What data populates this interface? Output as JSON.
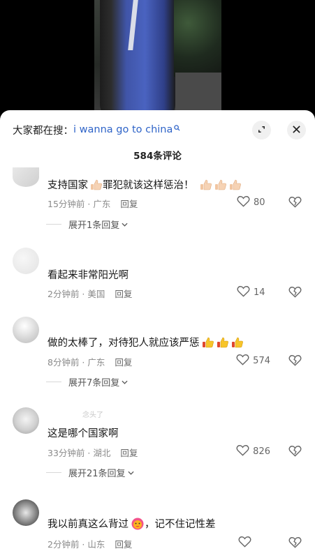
{
  "search": {
    "prefix": "大家都在搜：",
    "query": "i wanna go to china",
    "icon": "search-icon"
  },
  "header": {
    "comment_count_label": "584条评论",
    "expand_icon": "expand-icon",
    "close_icon": "close-icon"
  },
  "comments": [
    {
      "username": "",
      "text": "支持国家👍🏻罪犯就该这样惩治！",
      "text_main": "支持国家",
      "text_mid": "罪犯就该这样惩治！",
      "emoji": "thumbs-up-light",
      "time": "15分钟前",
      "location": "广东",
      "reply_label": "回复",
      "likes": "80",
      "replies_label": "展开1条回复"
    },
    {
      "username": "",
      "text": "看起来非常阳光啊",
      "time": "2分钟前",
      "location": "美国",
      "reply_label": "回复",
      "likes": "14",
      "replies_label": ""
    },
    {
      "username": "",
      "text": "做的太棒了，对待犯人就应该严惩",
      "emoji": "thumbs-up-yellow",
      "time": "8分钟前",
      "location": "广东",
      "reply_label": "回复",
      "likes": "574",
      "replies_label": "展开7条回复"
    },
    {
      "username": "念头了",
      "text": "这是哪个国家啊",
      "time": "33分钟前",
      "location": "湖北",
      "reply_label": "回复",
      "likes": "826",
      "replies_label": "展开21条回复"
    },
    {
      "username": "",
      "text": "我以前真这么背过🥵，记不住记性差",
      "text_main": "我以前真这么背过",
      "text_tail": "，记不住记性差",
      "emoji": "hot-face",
      "time": "2分钟前",
      "location": "山东",
      "reply_label": "回复",
      "likes": "",
      "replies_label": ""
    }
  ],
  "colors": {
    "accent_link": "#2f64c8",
    "meta_gray": "#8a8a8a",
    "sheet_bg": "#ffffff",
    "video_bg": "#000000"
  }
}
